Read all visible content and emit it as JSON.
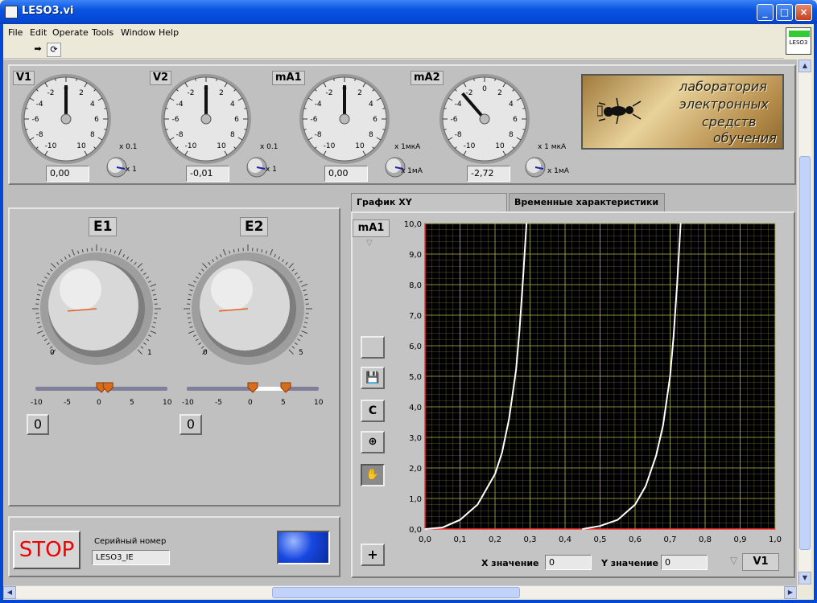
{
  "window": {
    "title": "LESO3.vi",
    "min_icon": "minimize-icon",
    "max_icon": "maximize-icon",
    "close_icon": "close-icon"
  },
  "menu": [
    "File",
    "Edit",
    "Operate",
    "Tools",
    "Window",
    "Help"
  ],
  "toolbar": {
    "run_icon": "run-arrow-icon",
    "continuous_icon": "run-continuous-icon"
  },
  "vi_icon_label": "LESO3",
  "meters": [
    {
      "label": "V1",
      "value": "0,00",
      "needle": 0,
      "range_hi": "x 0.1",
      "range_lo": "x 1"
    },
    {
      "label": "V2",
      "value": "-0,01",
      "needle": 0,
      "range_hi": "x 0.1",
      "range_lo": "x 1"
    },
    {
      "label": "mA1",
      "value": "0,00",
      "needle": 0,
      "range_hi": "x 1мкА",
      "range_lo": "x 1мА"
    },
    {
      "label": "mA2",
      "value": "-2,72",
      "needle": -2.72,
      "range_hi": "x 1 мкА",
      "range_lo": "x 1мА"
    }
  ],
  "meter_scale": [
    "-10",
    "-8",
    "-6",
    "-4",
    "-2",
    "0",
    "2",
    "4",
    "6",
    "8",
    "10"
  ],
  "logo": {
    "lines": [
      "лаборатория",
      "электронных",
      "средств",
      "обучения"
    ]
  },
  "sources": [
    {
      "label": "E1",
      "knob_min": "0",
      "knob_max": "1",
      "knob_fraction": 0.15,
      "slider_ticks": [
        "-10",
        "-5",
        "0",
        "5",
        "10"
      ],
      "marker_a": 0,
      "marker_b": 1,
      "digital": "0"
    },
    {
      "label": "E2",
      "knob_min": "0",
      "knob_max": "5",
      "knob_fraction": 0.15,
      "slider_ticks": [
        "-10",
        "-5",
        "0",
        "5",
        "10"
      ],
      "marker_a": 0,
      "marker_b": 5,
      "digital": "0"
    }
  ],
  "stop_label": "STOP",
  "serial": {
    "label": "Серийный номер",
    "value": "LESO3_IE"
  },
  "tabs": [
    {
      "label": "График XY",
      "active": true
    },
    {
      "label": "Временные характеристики",
      "active": false
    }
  ],
  "graph": {
    "y_selector": "mA1",
    "x_selector": "V1",
    "x_ticks": [
      "0,0",
      "0,1",
      "0,2",
      "0,3",
      "0,4",
      "0,5",
      "0,6",
      "0,7",
      "0,8",
      "0,9",
      "1,0"
    ],
    "y_ticks": [
      "0,0",
      "1,0",
      "2,0",
      "3,0",
      "4,0",
      "5,0",
      "6,0",
      "7,0",
      "8,0",
      "9,0",
      "10,0"
    ],
    "x_value_label": "X значение",
    "x_value": "0",
    "y_value_label": "Y значение",
    "y_value": "0",
    "colors": {
      "bg": "#000000",
      "grid": "#c8c85a",
      "curve": "#ffffff",
      "axis": "#ff3030"
    }
  },
  "graph_tools": {
    "c_label": "C"
  },
  "chart_data": {
    "type": "line",
    "title": "",
    "xlabel": "",
    "ylabel": "",
    "xlim": [
      0,
      1
    ],
    "ylim": [
      0,
      10
    ],
    "grid": true,
    "series": [
      {
        "x": [
          0,
          0.05,
          0.1,
          0.15,
          0.2,
          0.22,
          0.24,
          0.26,
          0.27,
          0.28,
          0.29
        ],
        "y": [
          0,
          0.05,
          0.3,
          0.8,
          1.8,
          2.5,
          3.6,
          5.2,
          6.5,
          8.2,
          10
        ]
      },
      {
        "x": [
          0.45,
          0.5,
          0.55,
          0.6,
          0.63,
          0.66,
          0.68,
          0.7,
          0.71,
          0.72,
          0.73
        ],
        "y": [
          0,
          0.1,
          0.3,
          0.8,
          1.4,
          2.4,
          3.4,
          5,
          6.3,
          8,
          10
        ]
      }
    ]
  }
}
